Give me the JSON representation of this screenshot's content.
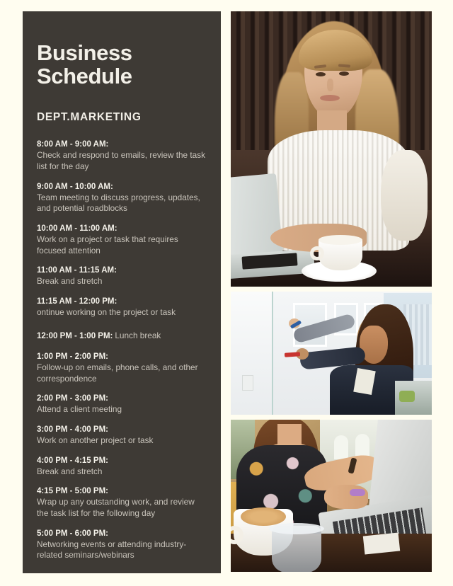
{
  "theme": {
    "page_background": "#fffdf0",
    "panel_background": "#3e3a35",
    "heading_color": "#f3f0e8",
    "body_text_color": "#c9c4bb"
  },
  "panel": {
    "title_line_1": "Business",
    "title_line_2": "Schedule",
    "department": "DEPT.MARKETING"
  },
  "schedule": [
    {
      "time": "8:00 AM - 9:00 AM:",
      "description": "Check and respond to emails, review the task list for the day",
      "inline": false
    },
    {
      "time": "9:00 AM - 10:00 AM:",
      "description": "Team meeting to discuss progress, updates, and potential roadblocks",
      "inline": false
    },
    {
      "time": "10:00 AM - 11:00 AM:",
      "description": "Work on a project or task that requires focused attention",
      "inline": false
    },
    {
      "time": "11:00 AM - 11:15 AM:",
      "description": "Break and stretch",
      "inline": false
    },
    {
      "time": "11:15 AM - 12:00 PM:",
      "description": "ontinue working on the project or task",
      "inline": false
    },
    {
      "time": "12:00 PM - 1:00 PM:",
      "description": "Lunch break",
      "inline": true
    },
    {
      "time": "1:00 PM - 2:00 PM:",
      "description": "Follow-up on emails, phone calls, and other correspondence",
      "inline": false
    },
    {
      "time": "2:00 PM - 3:00 PM:",
      "description": "Attend a client meeting",
      "inline": false
    },
    {
      "time": "3:00 PM - 4:00 PM:",
      "description": "Work on another project or task",
      "inline": false
    },
    {
      "time": "4:00 PM - 4:15 PM:",
      "description": "Break and stretch",
      "inline": false
    },
    {
      "time": "4:15 PM - 5:00 PM:",
      "description": "Wrap up any outstanding work, and review the task list for the following day",
      "inline": false
    },
    {
      "time": "5:00 PM - 6:00 PM:",
      "description": "Networking events or attending industry-related seminars/webinars",
      "inline": false
    }
  ],
  "photos": [
    {
      "name": "woman-laptop-cafe-dark",
      "caption": "Blonde woman in white blouse working on a laptop with a coffee cup"
    },
    {
      "name": "whiteboard-meeting",
      "caption": "Two businesswomen writing on a glass whiteboard in a bright office"
    },
    {
      "name": "woman-laptop-coffee",
      "caption": "Woman in floral top typing on a laptop beside a cappuccino"
    }
  ]
}
